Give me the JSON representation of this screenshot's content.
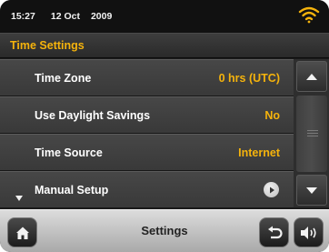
{
  "status_bar": {
    "time": "15:27",
    "date": "12 Oct",
    "year": "2009",
    "wifi_icon": "wifi-icon"
  },
  "header": {
    "title": "Time Settings"
  },
  "settings": {
    "rows": [
      {
        "label": "Time Zone",
        "value": "0 hrs (UTC)"
      },
      {
        "label": "Use Daylight Savings",
        "value": "No"
      },
      {
        "label": "Time Source",
        "value": "Internet"
      },
      {
        "label": "Manual Setup",
        "icon": "arrow-right-icon"
      }
    ]
  },
  "scrollbar": {
    "up_icon": "triangle-up-icon",
    "down_icon": "triangle-down-icon"
  },
  "bottom_bar": {
    "title": "Settings",
    "home_icon": "home-icon",
    "back_icon": "back-arrow-icon",
    "volume_icon": "volume-icon"
  },
  "colors": {
    "accent": "#f5b30c",
    "background": "#1b1b1b",
    "row": "#404040"
  }
}
